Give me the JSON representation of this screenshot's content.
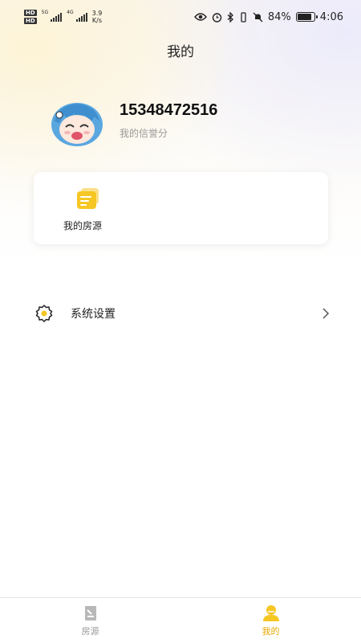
{
  "status_bar": {
    "hd_1": "HD",
    "hd_2": "HD",
    "net_1": "5G",
    "net_2": "4G",
    "speed_value": "3.9",
    "speed_unit": "K/s",
    "battery": "84%",
    "time": "4:06"
  },
  "header": {
    "title": "我的"
  },
  "profile": {
    "phone": "15348472516",
    "credit_label": "我的信誉分"
  },
  "quick_actions": [
    {
      "label": "我的房源",
      "icon": "notes-icon"
    }
  ],
  "menu": [
    {
      "label": "系统设置",
      "icon": "gear-icon"
    }
  ],
  "tabs": [
    {
      "label": "房源",
      "icon": "document-icon",
      "active": false
    },
    {
      "label": "我的",
      "icon": "user-icon",
      "active": true
    }
  ],
  "colors": {
    "accent": "#f5c518",
    "inactive_tab": "#9a9a9a",
    "active_tab_text": "#e6a800"
  }
}
